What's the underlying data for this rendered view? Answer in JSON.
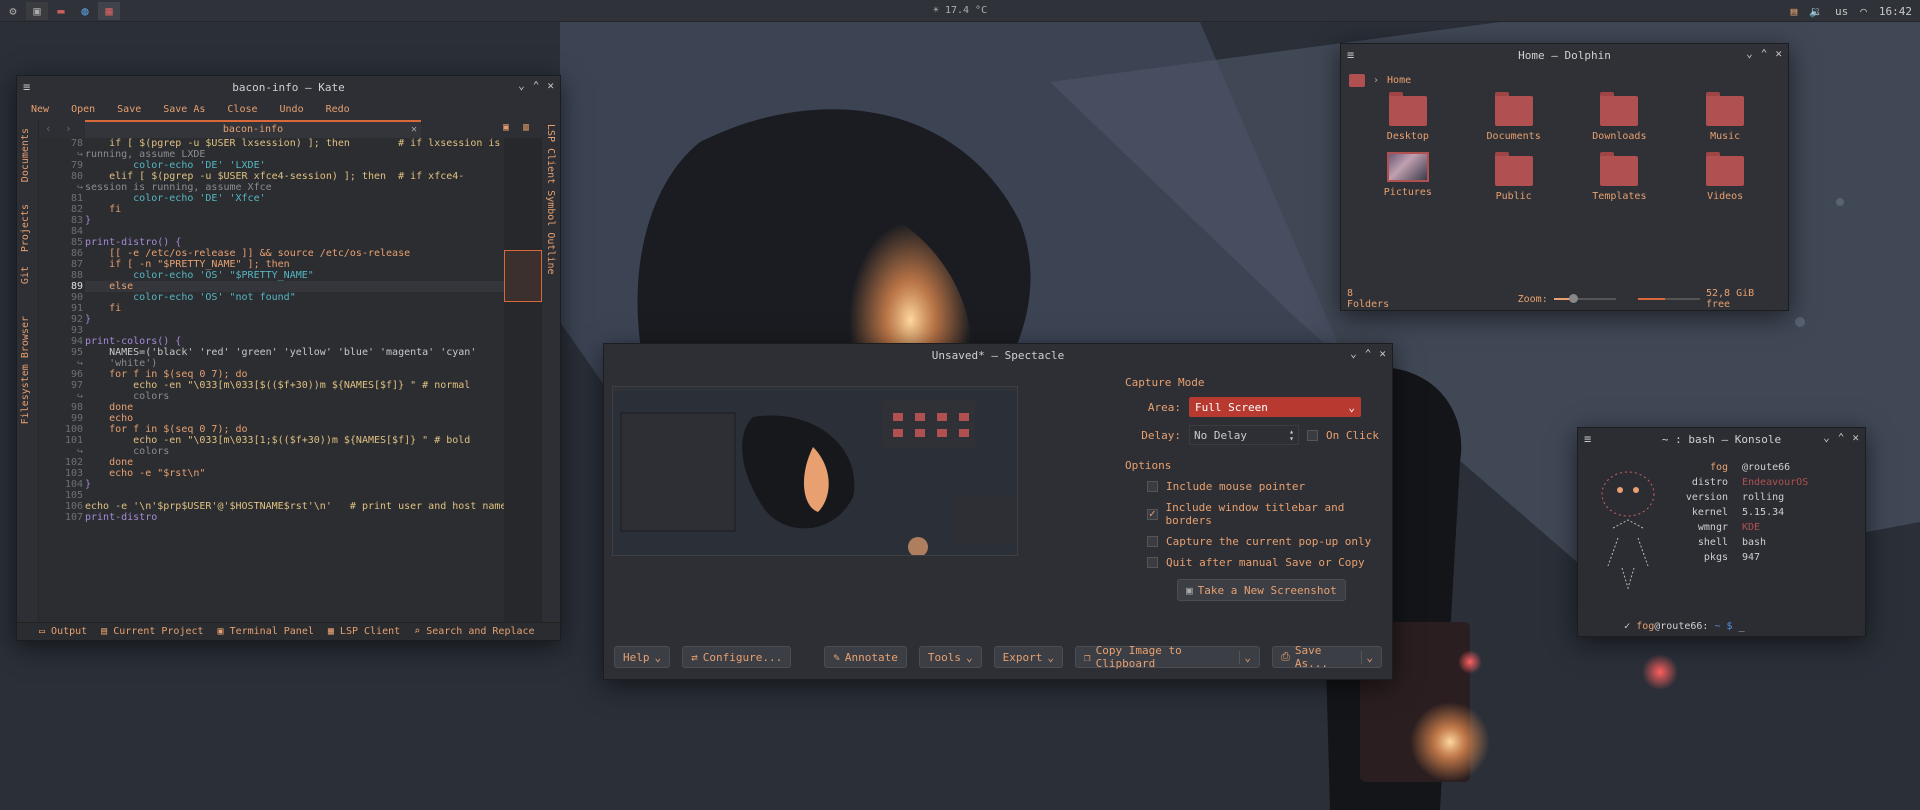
{
  "panel": {
    "weather": "☀ 17.4 °C",
    "layout": "us",
    "clock": "16:42",
    "tasks": [
      "terminal-icon",
      "files-icon",
      "browser-icon",
      "screenshot-icon"
    ]
  },
  "colors": {
    "accent": "#e8a070",
    "accent_red": "#d9693a",
    "bg": "#2d2f34",
    "folder": "#b05050"
  },
  "kate": {
    "title": "bacon-info — Kate",
    "menu": [
      "New",
      "Open",
      "Save",
      "Save As",
      "Close",
      "Undo",
      "Redo"
    ],
    "tab": "bacon-info",
    "side_tabs": [
      "Documents",
      "Projects",
      "Git",
      "Filesystem Browser"
    ],
    "right_tabs": [
      "LSP Client Symbol Outline"
    ],
    "status": [
      "Output",
      "Current Project",
      "Terminal Panel",
      "LSP Client",
      "Search and Replace"
    ],
    "lines": [
      {
        "n": "78",
        "t": "    if [ $(pgrep -u $USER lxsession) ]; then        # if lxsession is"
      },
      {
        "n": "↪",
        "t": "running, assume LXDE"
      },
      {
        "n": "79",
        "t": "        color-echo 'DE' 'LXDE'"
      },
      {
        "n": "80",
        "t": "    elif [ $(pgrep -u $USER xfce4-session) ]; then  # if xfce4-"
      },
      {
        "n": "↪",
        "t": "session is running, assume Xfce"
      },
      {
        "n": "81",
        "t": "        color-echo 'DE' 'Xfce'"
      },
      {
        "n": "82",
        "t": "    fi"
      },
      {
        "n": "83",
        "t": "}"
      },
      {
        "n": "84",
        "t": ""
      },
      {
        "n": "85",
        "t": "print-distro() {"
      },
      {
        "n": "86",
        "t": "    [[ -e /etc/os-release ]] && source /etc/os-release"
      },
      {
        "n": "87",
        "t": "    if [ -n \"$PRETTY_NAME\" ]; then"
      },
      {
        "n": "88",
        "t": "        color-echo 'OS' \"$PRETTY_NAME\""
      },
      {
        "n": "89",
        "t": "    else"
      },
      {
        "n": "90",
        "t": "        color-echo 'OS' \"not found\""
      },
      {
        "n": "91",
        "t": "    fi"
      },
      {
        "n": "92",
        "t": "}"
      },
      {
        "n": "93",
        "t": ""
      },
      {
        "n": "94",
        "t": "print-colors() {"
      },
      {
        "n": "95",
        "t": "    NAMES=('black' 'red' 'green' 'yellow' 'blue' 'magenta' 'cyan'"
      },
      {
        "n": "↪",
        "t": "    'white')"
      },
      {
        "n": "96",
        "t": "    for f in $(seq 0 7); do"
      },
      {
        "n": "97",
        "t": "        echo -en \"\\033[m\\033[$(($f+30))m ${NAMES[$f]} \" # normal"
      },
      {
        "n": "↪",
        "t": "        colors"
      },
      {
        "n": "98",
        "t": "    done"
      },
      {
        "n": "99",
        "t": "    echo"
      },
      {
        "n": "100",
        "t": "    for f in $(seq 0 7); do"
      },
      {
        "n": "101",
        "t": "        echo -en \"\\033[m\\033[1;$(($f+30))m ${NAMES[$f]} \" # bold"
      },
      {
        "n": "↪",
        "t": "        colors"
      },
      {
        "n": "102",
        "t": "    done"
      },
      {
        "n": "103",
        "t": "    echo -e \"$rst\\n\""
      },
      {
        "n": "104",
        "t": "}"
      },
      {
        "n": "105",
        "t": ""
      },
      {
        "n": "106",
        "t": "echo -e '\\n'$prp$USER'@'$HOSTNAME$rst'\\n'   # print user and host name"
      },
      {
        "n": "107",
        "t": "print-distro"
      }
    ]
  },
  "dolphin": {
    "title": "Home — Dolphin",
    "breadcrumb": "Home",
    "folders": [
      "Desktop",
      "Documents",
      "Downloads",
      "Music",
      "Pictures",
      "Public",
      "Templates",
      "Videos"
    ],
    "status": "8 Folders",
    "zoom_label": "Zoom:",
    "zoom_level": 0.3,
    "free_fraction": 0.42,
    "free": "52,8 GiB free"
  },
  "spectacle": {
    "title": "Unsaved* — Spectacle",
    "capture_mode": "Capture Mode",
    "area_label": "Area:",
    "area_value": "Full Screen",
    "delay_label": "Delay:",
    "delay_value": "No Delay",
    "on_click": "On Click",
    "options_label": "Options",
    "options": [
      {
        "label": "Include mouse pointer",
        "checked": false
      },
      {
        "label": "Include window titlebar and borders",
        "checked": true
      },
      {
        "label": "Capture the current pop-up only",
        "checked": false
      },
      {
        "label": "Quit after manual Save or Copy",
        "checked": false
      }
    ],
    "new_shot": "Take a New Screenshot",
    "buttons": {
      "help": "Help",
      "configure": "Configure...",
      "annotate": "Annotate",
      "tools": "Tools",
      "export": "Export",
      "copy": "Copy Image to Clipboard",
      "save": "Save As..."
    }
  },
  "konsole": {
    "title": "~ : bash — Konsole",
    "fetch": [
      {
        "k": "fog",
        "v": "@route66"
      },
      {
        "k": "distro",
        "v": "EndeavourOS"
      },
      {
        "k": "version",
        "v": "rolling"
      },
      {
        "k": "kernel",
        "v": "5.15.34"
      },
      {
        "k": "wmngr",
        "v": "KDE"
      },
      {
        "k": "shell",
        "v": "bash"
      },
      {
        "k": "pkgs",
        "v": "947"
      }
    ],
    "prompt": {
      "check": "✓",
      "user": "fog",
      "host": "@route66:",
      "path": "~",
      "sign": "$",
      "cursor": "_"
    }
  }
}
